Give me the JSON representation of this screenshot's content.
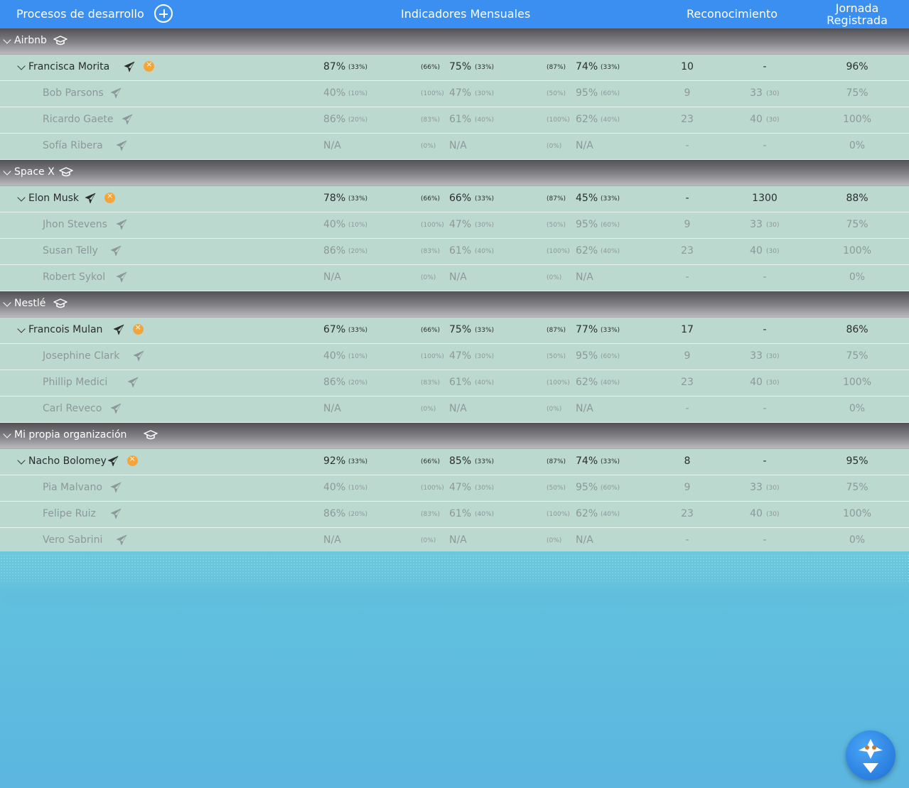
{
  "header": {
    "col1": "Procesos de desarrollo",
    "col2": "Indicadores Mensuales",
    "col3": "Reconocimiento",
    "col4_line1": "Jornada",
    "col4_line2": "Registrada"
  },
  "groups": [
    {
      "name": "Airbnb",
      "lead": {
        "name": "Francisca Morita",
        "i1": "87%",
        "i1s": "(33%)",
        "i2p": "(66%)",
        "i2": "75%",
        "i2s": "(33%)",
        "i3p": "(87%)",
        "i3": "74%",
        "i3s": "(33%)",
        "r1": "10",
        "r2": "-",
        "r2s": "",
        "j": "96%"
      },
      "members": [
        {
          "name": "Bob Parsons",
          "i1": "40%",
          "i1s": "(10%)",
          "i2p": "(100%)",
          "i2": "47%",
          "i2s": "(30%)",
          "i3p": "(50%)",
          "i3": "95%",
          "i3s": "(60%)",
          "r1": "9",
          "r2": "33",
          "r2s": "(30)",
          "j": "75%"
        },
        {
          "name": "Ricardo Gaete",
          "i1": "86%",
          "i1s": "(20%)",
          "i2p": "(83%)",
          "i2": "61%",
          "i2s": "(40%)",
          "i3p": "(100%)",
          "i3": "62%",
          "i3s": "(40%)",
          "r1": "23",
          "r2": "40",
          "r2s": "(30)",
          "j": "100%"
        },
        {
          "name": "Sofía Ribera",
          "i1": "N/A",
          "i1s": "",
          "i2p": "(0%)",
          "i2": "N/A",
          "i2s": "",
          "i3p": "(0%)",
          "i3": "N/A",
          "i3s": "",
          "r1": "-",
          "r2": "-",
          "r2s": "",
          "j": "0%"
        }
      ]
    },
    {
      "name": "Space X",
      "lead": {
        "name": "Elon Musk",
        "i1": "78%",
        "i1s": "(33%)",
        "i2p": "(66%)",
        "i2": "66%",
        "i2s": "(33%)",
        "i3p": "(87%)",
        "i3": "45%",
        "i3s": "(33%)",
        "r1": "-",
        "r2": "1300",
        "r2s": "",
        "j": "88%"
      },
      "members": [
        {
          "name": "Jhon Stevens",
          "i1": "40%",
          "i1s": "(10%)",
          "i2p": "(100%)",
          "i2": "47%",
          "i2s": "(30%)",
          "i3p": "(50%)",
          "i3": "95%",
          "i3s": "(60%)",
          "r1": "9",
          "r2": "33",
          "r2s": "(30)",
          "j": "75%"
        },
        {
          "name": "Susan Telly",
          "i1": "86%",
          "i1s": "(20%)",
          "i2p": "(83%)",
          "i2": "61%",
          "i2s": "(40%)",
          "i3p": "(100%)",
          "i3": "62%",
          "i3s": "(40%)",
          "r1": "23",
          "r2": "40",
          "r2s": "(30)",
          "j": "100%"
        },
        {
          "name": "Robert Sykol",
          "i1": "N/A",
          "i1s": "",
          "i2p": "(0%)",
          "i2": "N/A",
          "i2s": "",
          "i3p": "(0%)",
          "i3": "N/A",
          "i3s": "",
          "r1": "-",
          "r2": "-",
          "r2s": "",
          "j": "0%"
        }
      ]
    },
    {
      "name": "Nestlé",
      "lead": {
        "name": "Francois Mulan",
        "i1": "67%",
        "i1s": "(33%)",
        "i2p": "(66%)",
        "i2": "75%",
        "i2s": "(33%)",
        "i3p": "(87%)",
        "i3": "77%",
        "i3s": "(33%)",
        "r1": "17",
        "r2": "-",
        "r2s": "",
        "j": "86%"
      },
      "members": [
        {
          "name": "Josephine Clark",
          "i1": "40%",
          "i1s": "(10%)",
          "i2p": "(100%)",
          "i2": "47%",
          "i2s": "(30%)",
          "i3p": "(50%)",
          "i3": "95%",
          "i3s": "(60%)",
          "r1": "9",
          "r2": "33",
          "r2s": "(30)",
          "j": "75%"
        },
        {
          "name": "Phillip Medici",
          "i1": "86%",
          "i1s": "(20%)",
          "i2p": "(83%)",
          "i2": "61%",
          "i2s": "(40%)",
          "i3p": "(100%)",
          "i3": "62%",
          "i3s": "(40%)",
          "r1": "23",
          "r2": "40",
          "r2s": "(30)",
          "j": "100%"
        },
        {
          "name": "Carl Reveco",
          "i1": "N/A",
          "i1s": "",
          "i2p": "(0%)",
          "i2": "N/A",
          "i2s": "",
          "i3p": "(0%)",
          "i3": "N/A",
          "i3s": "",
          "r1": "-",
          "r2": "-",
          "r2s": "",
          "j": "0%"
        }
      ]
    },
    {
      "name": "Mi propia organización",
      "lead": {
        "name": "Nacho Bolomey",
        "i1": "92%",
        "i1s": "(33%)",
        "i2p": "(66%)",
        "i2": "85%",
        "i2s": "(33%)",
        "i3p": "(87%)",
        "i3": "74%",
        "i3s": "(33%)",
        "r1": "8",
        "r2": "-",
        "r2s": "",
        "j": "95%"
      },
      "members": [
        {
          "name": "Pia Malvano",
          "i1": "40%",
          "i1s": "(10%)",
          "i2p": "(100%)",
          "i2": "47%",
          "i2s": "(30%)",
          "i3p": "(50%)",
          "i3": "95%",
          "i3s": "(60%)",
          "r1": "9",
          "r2": "33",
          "r2s": "(30)",
          "j": "75%"
        },
        {
          "name": "Felipe Ruiz",
          "i1": "86%",
          "i1s": "(20%)",
          "i2p": "(83%)",
          "i2": "61%",
          "i2s": "(40%)",
          "i3p": "(100%)",
          "i3": "62%",
          "i3s": "(40%)",
          "r1": "23",
          "r2": "40",
          "r2s": "(30)",
          "j": "100%"
        },
        {
          "name": "Vero Sabrini",
          "i1": "N/A",
          "i1s": "",
          "i2p": "(0%)",
          "i2": "N/A",
          "i2s": "",
          "i3p": "(0%)",
          "i3": "N/A",
          "i3s": "",
          "r1": "-",
          "r2": "-",
          "r2s": "",
          "j": "0%"
        }
      ]
    }
  ],
  "icons": {
    "add": "plus-circle-icon",
    "group": "graduation-cap-icon",
    "send": "paper-plane-icon",
    "status": "orange-x-badge-icon",
    "assistant": "assistant-avatar-icon"
  },
  "colors": {
    "header": "#3a8ff0",
    "row": "#bcd9d0",
    "badge": "#f3a53c"
  }
}
